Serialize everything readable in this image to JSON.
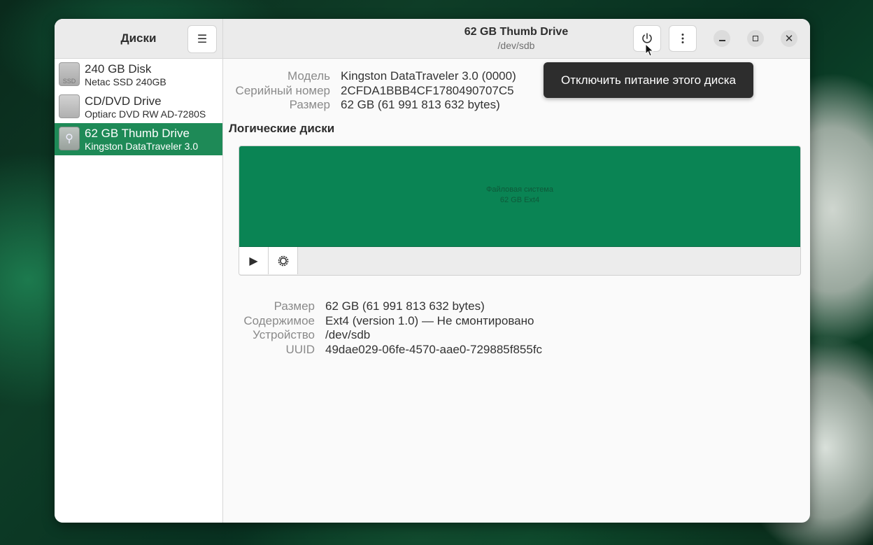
{
  "sidebar": {
    "title": "Диски",
    "drives": [
      {
        "name": "240 GB Disk",
        "sub": "Netac SSD 240GB",
        "icon": "ssd-drive-icon",
        "icon_text": "SSD"
      },
      {
        "name": "CD/DVD Drive",
        "sub": "Optiarc DVD RW AD-7280S",
        "icon": "optical-drive-icon"
      },
      {
        "name": "62 GB Thumb Drive",
        "sub": "Kingston DataTraveler 3.0",
        "icon": "usb-drive-icon",
        "selected": true
      }
    ]
  },
  "header": {
    "title": "62 GB Thumb Drive",
    "subtitle": "/dev/sdb"
  },
  "drive_info": {
    "model_label": "Модель",
    "model_value": "Kingston DataTraveler 3.0 (0000)",
    "serial_label": "Серийный номер",
    "serial_value": "2CFDA1BBB4CF1780490707C5",
    "size_label": "Размер",
    "size_value": "62 GB (61 991 813 632 bytes)"
  },
  "volumes": {
    "title": "Логические диски",
    "partition_line1": "Файловая система",
    "partition_line2": "62 GB Ext4",
    "partition_color": "#0a8454"
  },
  "volume_info": {
    "size_label": "Размер",
    "size_value": "62 GB (61 991 813 632 bytes)",
    "contents_label": "Содержимое",
    "contents_value": "Ext4 (version 1.0) — Не смонтировано",
    "device_label": "Устройство",
    "device_value": "/dev/sdb",
    "uuid_label": "UUID",
    "uuid_value": "49dae029-06fe-4570-aae0-729885f855fc"
  },
  "tooltip": {
    "text": "Отключить питание этого диска"
  },
  "colors": {
    "accent": "#1e8a57",
    "tooltip_bg": "#2d2d2d"
  }
}
